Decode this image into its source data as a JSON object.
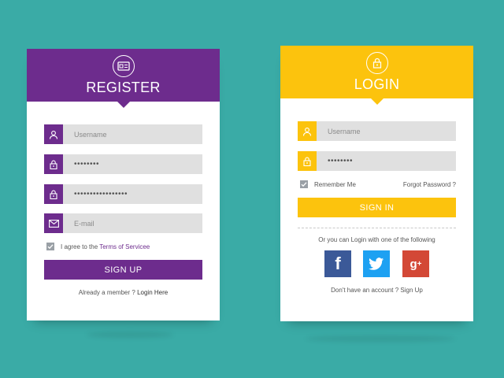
{
  "register": {
    "title": "REGISTER",
    "fields": [
      {
        "placeholder": "Username",
        "icon": "user-icon"
      },
      {
        "value": "••••••••",
        "icon": "lock-icon"
      },
      {
        "value": "•••••••••••••••••",
        "icon": "lock-icon"
      },
      {
        "placeholder": "E-mail",
        "icon": "mail-icon"
      }
    ],
    "agree_text": "I agree to the ",
    "terms_link": "Terms of Servicee",
    "button": "SIGN UP",
    "member_text": "Already a member ? ",
    "login_link": "Login Here",
    "colors": {
      "accent": "#6d2c8d"
    }
  },
  "login": {
    "title": "LOGIN",
    "fields": [
      {
        "placeholder": "Username",
        "icon": "user-icon"
      },
      {
        "value": "••••••••",
        "icon": "lock-icon"
      }
    ],
    "remember": "Remember Me",
    "forgot": "Forgot Password ?",
    "button": "SIGN IN",
    "or_text": "Or you can Login with one of the following",
    "social": [
      "facebook-icon",
      "twitter-icon",
      "google-plus-icon"
    ],
    "no_account": "Don't have an account ? ",
    "signup_link": "Sign Up",
    "colors": {
      "accent": "#fcc30d"
    }
  },
  "background_color": "#3aaba6"
}
